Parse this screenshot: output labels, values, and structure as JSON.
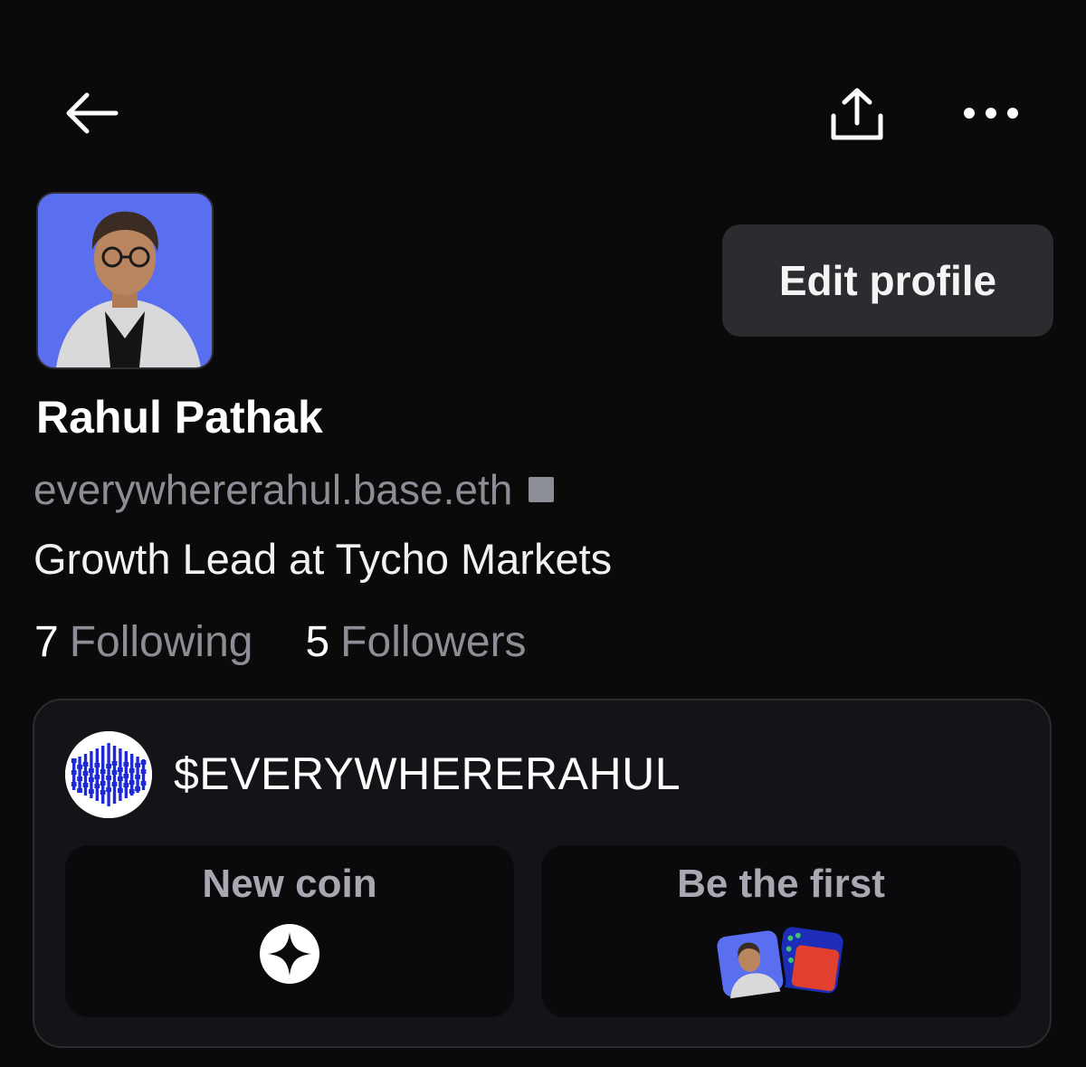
{
  "header": {
    "back_icon": "arrow-left-icon",
    "share_icon": "share-upload-icon",
    "more_icon": "ellipsis-horizontal-icon"
  },
  "profile": {
    "avatar": "profile-photo",
    "edit_label": "Edit profile",
    "name": "Rahul Pathak",
    "handle": "everywhererahul.base.eth",
    "bio": "Growth Lead at Tycho Markets",
    "following_count": "7",
    "following_label": "Following",
    "followers_count": "5",
    "followers_label": "Followers"
  },
  "coin": {
    "ticker": "$EVERYWHERERAHUL",
    "logo": "coin-logo-icon",
    "new_coin_label": "New coin",
    "new_coin_icon": "sparkle-star-icon",
    "be_first_label": "Be the first",
    "be_first_icon": "stacked-avatars"
  },
  "colors": {
    "background": "#0a0a0b",
    "button_bg": "#2b2b30",
    "muted_text": "#8c8e96",
    "avatar_bg": "#5a6ff0",
    "coin_blue": "#1e2ad6"
  }
}
